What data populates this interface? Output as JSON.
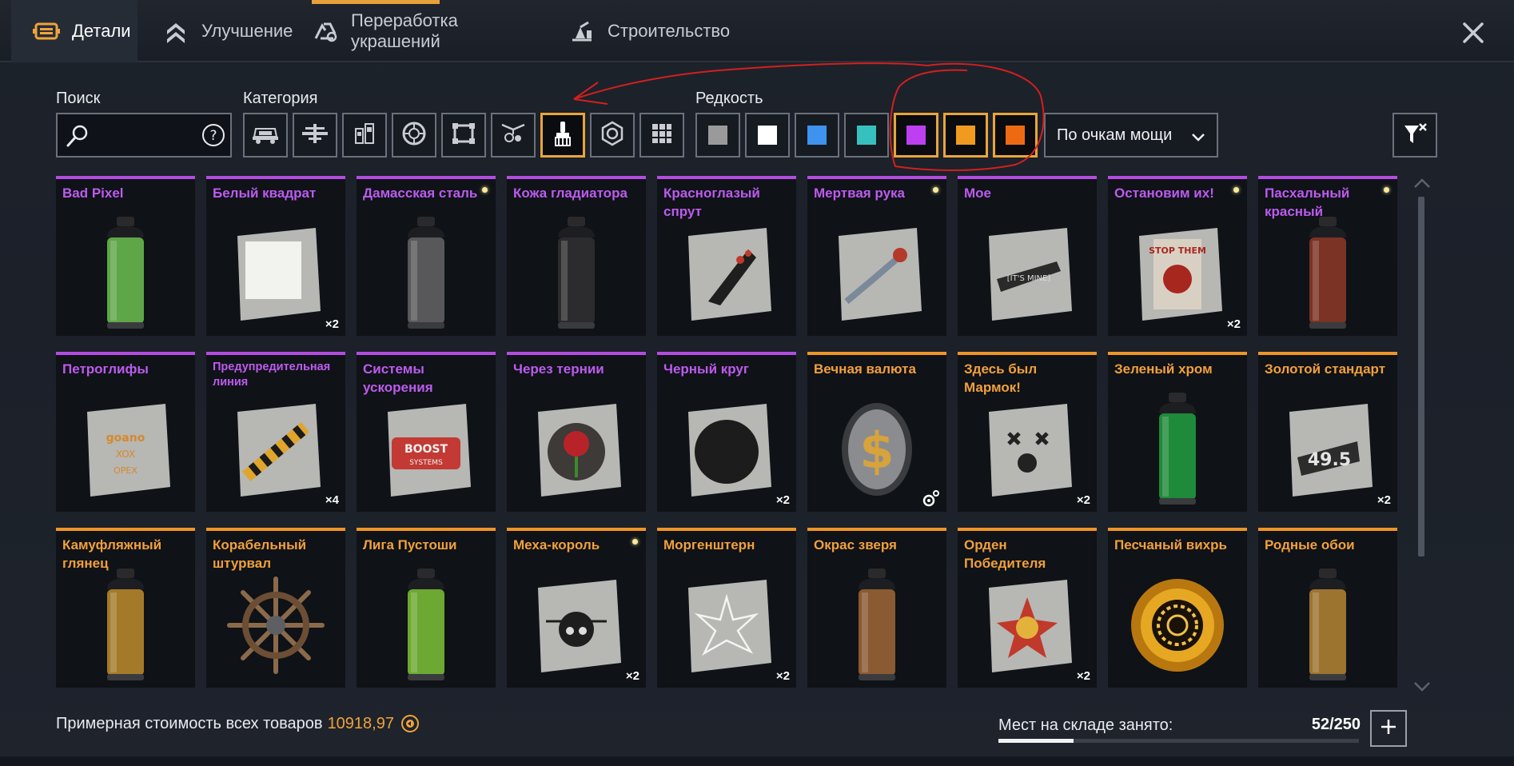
{
  "tabs": [
    {
      "label": "Детали",
      "active": true,
      "icon": "parts-icon"
    },
    {
      "label": "Улучшение",
      "active": false,
      "icon": "upgrade-chevrons-icon"
    },
    {
      "label": "Переработка украшений",
      "active": false,
      "icon": "recycle-decor-icon"
    },
    {
      "label": "Строительство",
      "active": false,
      "icon": "construction-icon"
    }
  ],
  "filters": {
    "search_label": "Поиск",
    "search_value": "",
    "category_label": "Категория",
    "categories": [
      "cabin-icon",
      "frame-icon",
      "weapon-module-icon",
      "wheel-icon",
      "structure-icon",
      "decor-icon",
      "paint-brush-icon",
      "hex-nut-icon",
      "grid-icon"
    ],
    "selected_category": "paint-brush-icon",
    "rarity_label": "Редкость",
    "rarities": [
      {
        "name": "common",
        "color": "#9a9a9a"
      },
      {
        "name": "uncommon",
        "color": "#ffffff"
      },
      {
        "name": "rare",
        "color": "#3f93ee"
      },
      {
        "name": "special",
        "color": "#37c0c0"
      },
      {
        "name": "epic",
        "color": "#bd3ff2"
      },
      {
        "name": "legendary",
        "color": "#f09a1f"
      },
      {
        "name": "relic",
        "color": "#ee6a12"
      }
    ],
    "selected_rarities": [
      "epic",
      "legendary",
      "relic"
    ],
    "sort_value": "По очкам мощи"
  },
  "items": [
    {
      "name": "Bad Pixel",
      "rarity": "epic",
      "kind": "spray",
      "color": "#5fa648",
      "dot": false,
      "count": ""
    },
    {
      "name": "Белый квадрат",
      "rarity": "epic",
      "kind": "sticker",
      "motif": "square",
      "dot": false,
      "count": "×2"
    },
    {
      "name": "Дамасская сталь",
      "rarity": "epic",
      "kind": "spray",
      "color": "#58585a",
      "dot": true,
      "count": ""
    },
    {
      "name": "Кожа гладиатора",
      "rarity": "epic",
      "kind": "spray",
      "color": "#2c2c2e",
      "dot": false,
      "count": ""
    },
    {
      "name": "Красноглазый спрут",
      "rarity": "epic",
      "kind": "sticker",
      "motif": "slash",
      "dot": false,
      "count": ""
    },
    {
      "name": "Мертвая рука",
      "rarity": "epic",
      "kind": "sticker",
      "motif": "arm",
      "dot": true,
      "count": ""
    },
    {
      "name": "Мое",
      "rarity": "epic",
      "kind": "sticker",
      "motif": "brush",
      "dot": false,
      "count": ""
    },
    {
      "name": "Остановим их!",
      "rarity": "epic",
      "kind": "sticker",
      "motif": "poster",
      "dot": true,
      "count": "×2"
    },
    {
      "name": "Пасхальный красный",
      "rarity": "epic",
      "kind": "spray",
      "color": "#7a3324",
      "dot": true,
      "count": ""
    },
    {
      "name": "Петроглифы",
      "rarity": "epic",
      "kind": "sticker",
      "motif": "logos",
      "dot": false,
      "count": ""
    },
    {
      "name": "Предупредительная линия",
      "rarity": "epic",
      "kind": "sticker",
      "motif": "hazard",
      "dot": false,
      "count": "×4",
      "small": true
    },
    {
      "name": "Системы ускорения",
      "rarity": "epic",
      "kind": "sticker",
      "motif": "boost",
      "dot": false,
      "count": ""
    },
    {
      "name": "Через тернии",
      "rarity": "epic",
      "kind": "sticker",
      "motif": "rose",
      "dot": false,
      "count": ""
    },
    {
      "name": "Черный круг",
      "rarity": "epic",
      "kind": "sticker",
      "motif": "circle",
      "dot": false,
      "count": "×2"
    },
    {
      "name": "Вечная валюта",
      "rarity": "legendary",
      "kind": "coin",
      "dot": false,
      "count": "",
      "gear": true
    },
    {
      "name": "Здесь был Мармок!",
      "rarity": "legendary",
      "kind": "sticker",
      "motif": "face",
      "dot": false,
      "count": "×2"
    },
    {
      "name": "Зеленый хром",
      "rarity": "legendary",
      "kind": "spray",
      "color": "#1f8a3a",
      "dot": false,
      "count": ""
    },
    {
      "name": "Золотой стандарт",
      "rarity": "legendary",
      "kind": "sticker",
      "motif": "number",
      "dot": false,
      "count": "×2"
    },
    {
      "name": "Камуфляжный глянец",
      "rarity": "legendary",
      "kind": "spray",
      "color": "#a47a2a",
      "dot": false,
      "count": ""
    },
    {
      "name": "Корабельный штурвал",
      "rarity": "legendary",
      "kind": "wheel",
      "dot": false,
      "count": ""
    },
    {
      "name": "Лига Пустоши",
      "rarity": "legendary",
      "kind": "spray",
      "color": "#6da833",
      "dot": false,
      "count": ""
    },
    {
      "name": "Меха-король",
      "rarity": "legendary",
      "kind": "sticker",
      "motif": "skull",
      "dot": true,
      "count": "×2"
    },
    {
      "name": "Моргенштерн",
      "rarity": "legendary",
      "kind": "sticker",
      "motif": "star",
      "dot": false,
      "count": "×2"
    },
    {
      "name": "Окрас зверя",
      "rarity": "legendary",
      "kind": "spray",
      "color": "#8a5a32",
      "dot": false,
      "count": ""
    },
    {
      "name": "Орден Победителя",
      "rarity": "legendary",
      "kind": "sticker",
      "motif": "order",
      "dot": false,
      "count": "×2"
    },
    {
      "name": "Песчаный вихрь",
      "rarity": "legendary",
      "kind": "vortex",
      "dot": false,
      "count": ""
    },
    {
      "name": "Родные обои",
      "rarity": "legendary",
      "kind": "spray",
      "color": "#9c7430",
      "dot": false,
      "count": ""
    }
  ],
  "footer": {
    "cost_label": "Примерная стоимость всех товаров",
    "cost_value": "10918,97",
    "storage_label": "Мест на складе занято:",
    "storage_value": "52/250",
    "storage_fraction": 0.208
  }
}
